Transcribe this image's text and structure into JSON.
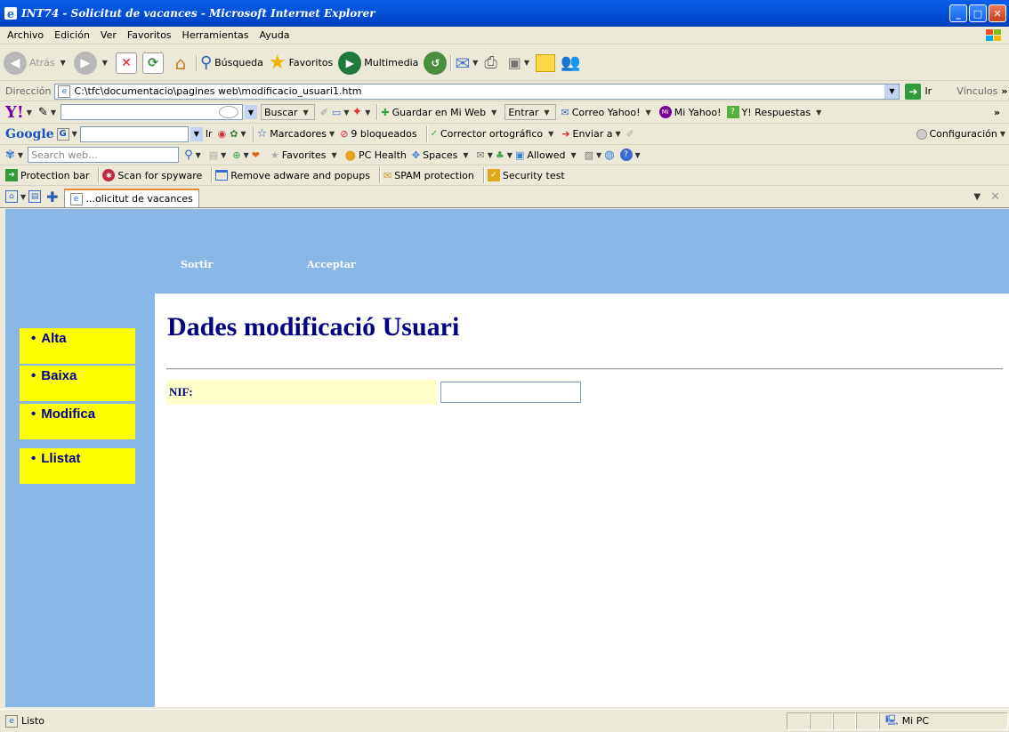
{
  "window": {
    "title": "INT74 - Solicitut de vacances - Microsoft Internet Explorer",
    "min": "_",
    "max": "□",
    "close": "✕"
  },
  "menu": [
    "Archivo",
    "Edición",
    "Ver",
    "Favoritos",
    "Herramientas",
    "Ayuda"
  ],
  "toolbar": {
    "back": "Atrás",
    "search": "Búsqueda",
    "favorites": "Favoritos",
    "multimedia": "Multimedia"
  },
  "address": {
    "label": "Dirección",
    "url": "C:\\tfc\\documentacio\\pagines web\\modificacio_usuari1.htm",
    "go": "Ir",
    "links": "Vínculos"
  },
  "yahoo": {
    "logo": "Y!",
    "search": "Buscar",
    "save": "Guardar en Mi Web",
    "enter": "Entrar",
    "mail": "Correo Yahoo!",
    "my": "Mi Yahoo!",
    "answers": "Y! Respuestas"
  },
  "google": {
    "logo": "Google",
    "go": "Ir",
    "bookmarks": "Marcadores",
    "blocked": "9 bloqueados",
    "spell": "Corrector ortográfico",
    "send": "Enviar a",
    "settings": "Configuración"
  },
  "msn": {
    "placeholder": "Search web...",
    "favorites": "Favorites",
    "health": "PC Health",
    "spaces": "Spaces",
    "allowed": "Allowed"
  },
  "protection": {
    "items": [
      "Protection bar",
      "Scan for spyware",
      "Remove adware and popups",
      "SPAM protection",
      "Security test"
    ]
  },
  "tab": {
    "label": "...olicitut de vacances"
  },
  "page": {
    "nav_top": {
      "exit": "Sortir",
      "accept": "Acceptar"
    },
    "side_menu": [
      "Alta",
      "Baixa",
      "Modifica",
      "Llistat"
    ],
    "heading": "Dades modificació Usuari",
    "form": {
      "nif_label": "NIF:",
      "nif_value": ""
    }
  },
  "status": {
    "left": "Listo",
    "zone": "Mi PC"
  },
  "colors": {
    "title_blue": "#0251d6",
    "page_blue": "#8ab8e6",
    "menu_yellow": "#ffff00",
    "heading": "#000080",
    "field_bg": "#ffffcc"
  }
}
